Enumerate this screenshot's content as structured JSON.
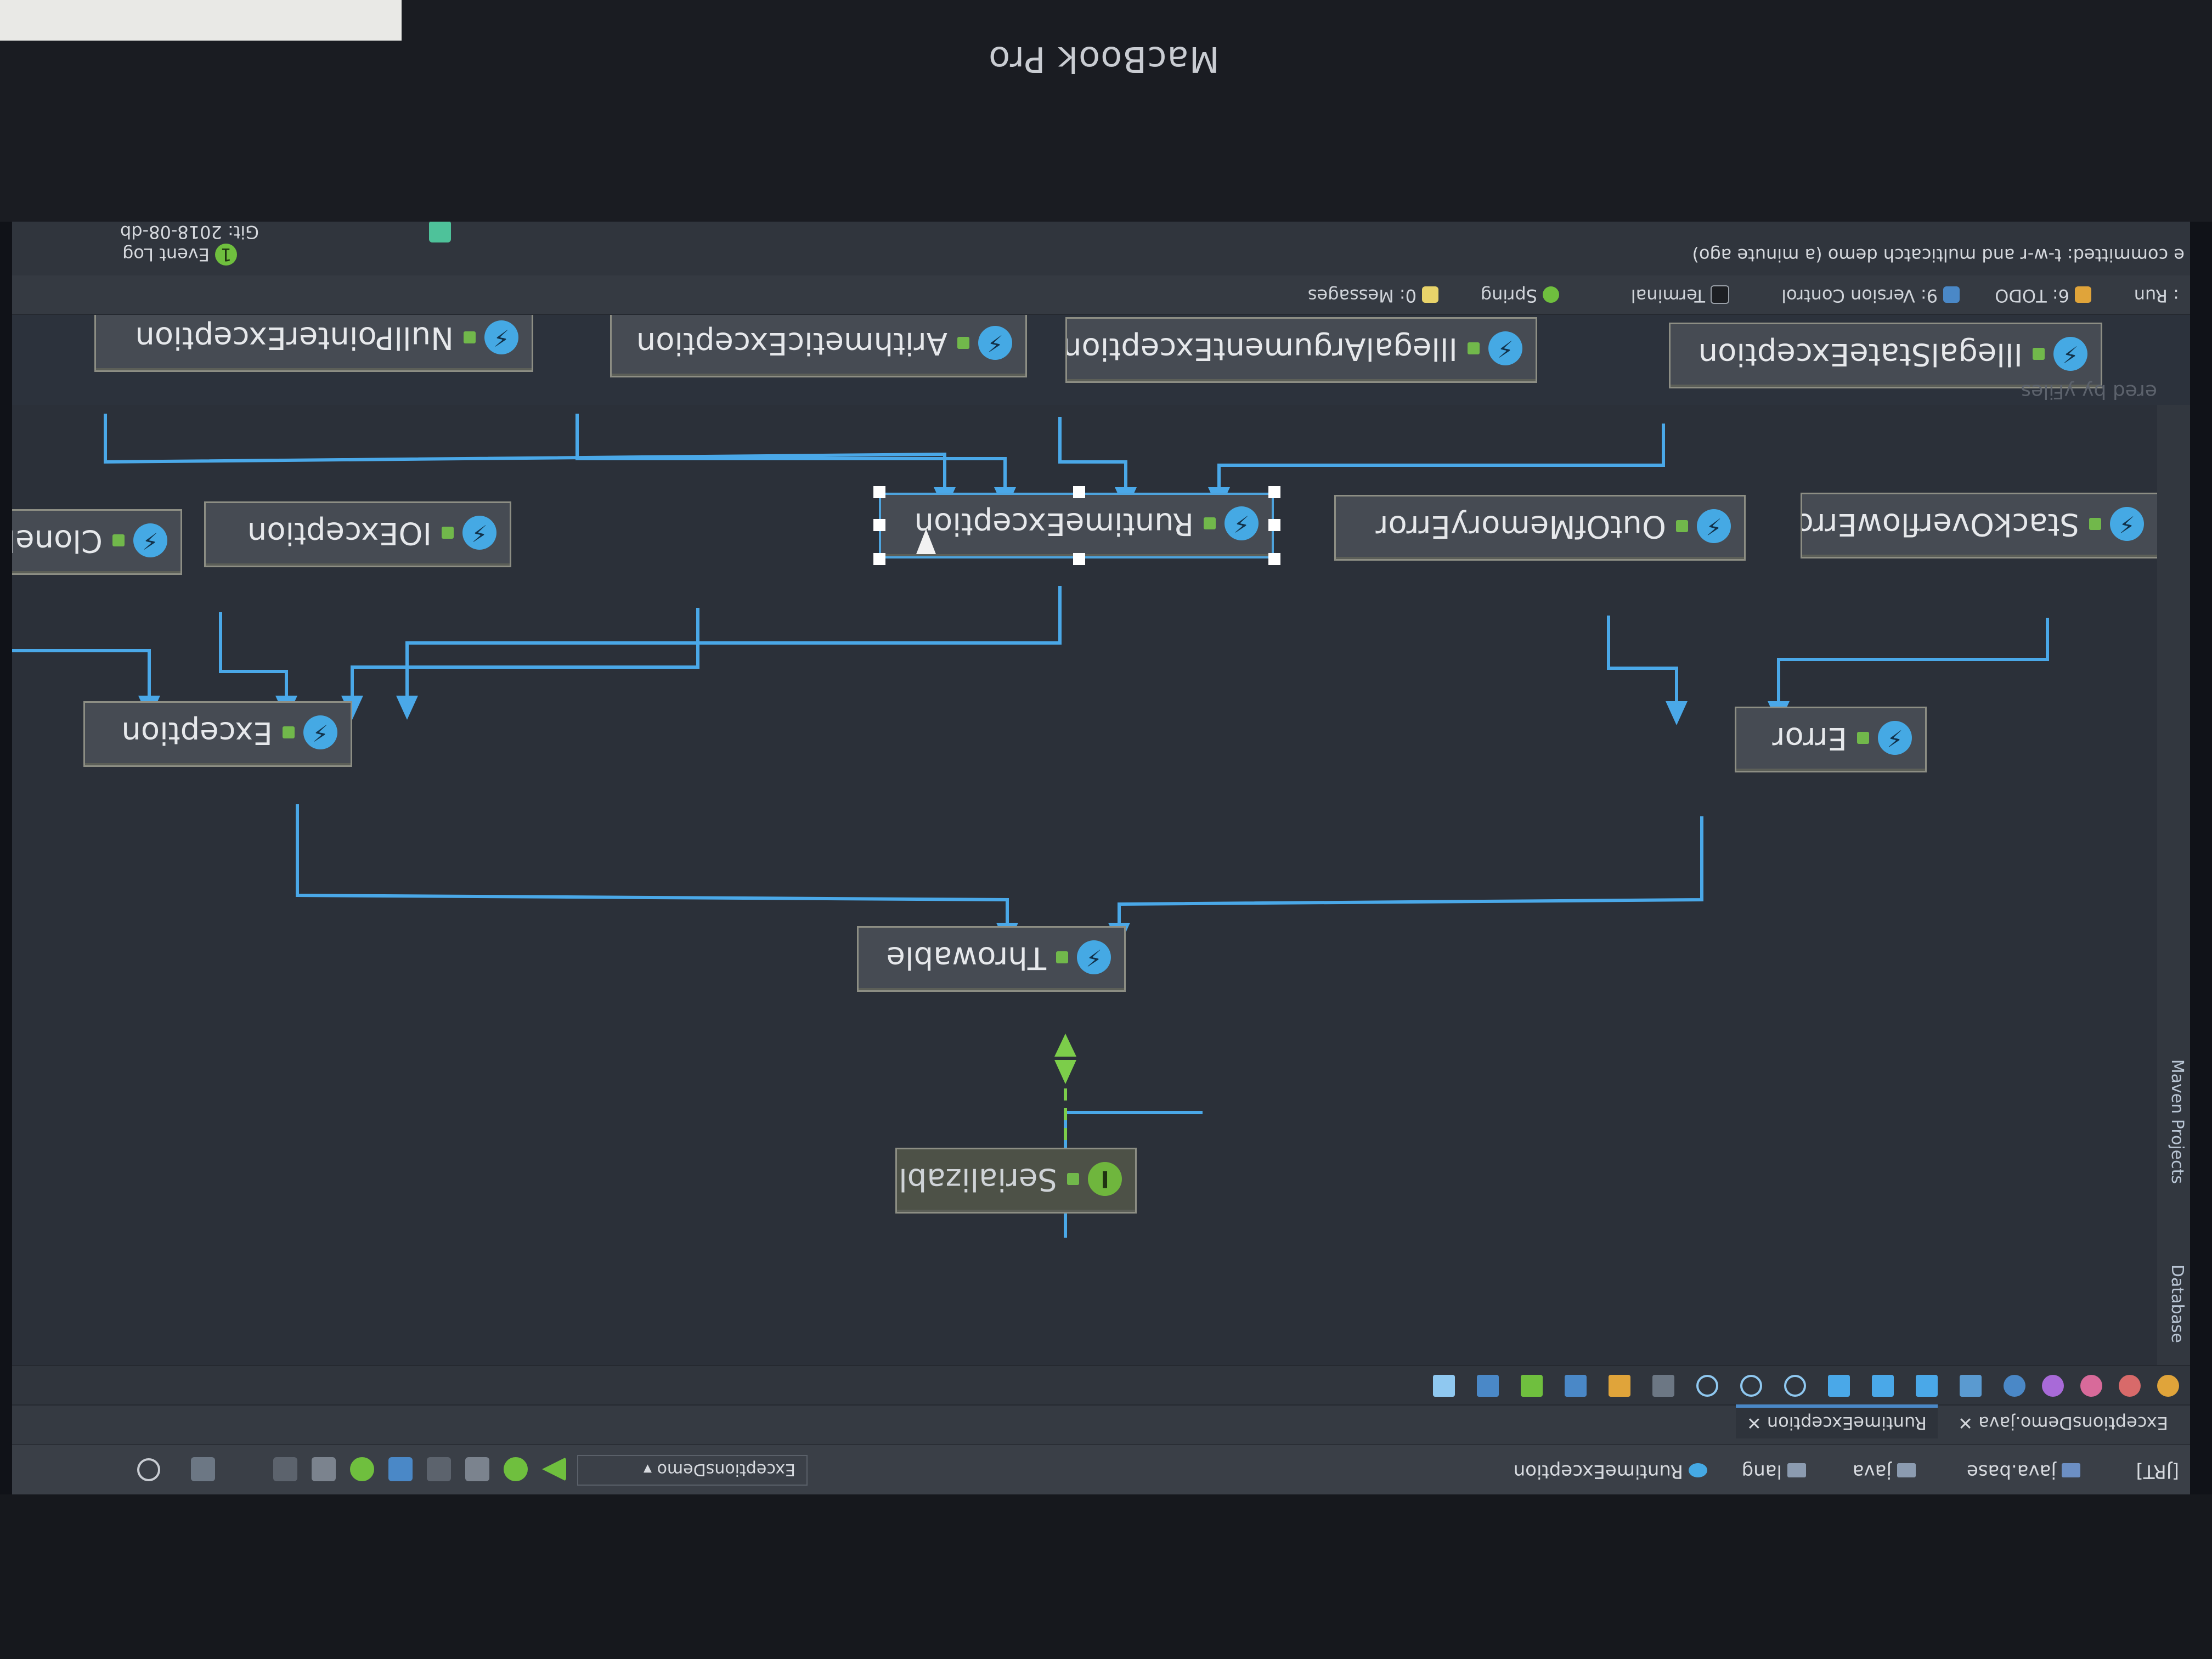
{
  "device": {
    "label": "MacBook Pro"
  },
  "breadcrumb": [
    {
      "label": "[JRT]"
    },
    {
      "label": "java.base"
    },
    {
      "label": "java"
    },
    {
      "label": "lang"
    },
    {
      "label": "RuntimeException"
    }
  ],
  "run_config": {
    "label": "ExceptionsDemo"
  },
  "tabs": [
    {
      "label": "ExceptionsDemo.java"
    },
    {
      "label": "RuntimeException"
    }
  ],
  "side_tools": [
    {
      "label": "Database"
    },
    {
      "label": "Maven Projects"
    }
  ],
  "diagram": {
    "watermark": "ered by yFiles",
    "nodes": [
      {
        "label": "Serializable",
        "kind": "interface",
        "icon": "I"
      },
      {
        "label": "Throwable",
        "kind": "class",
        "icon": "⚡"
      },
      {
        "label": "Exception",
        "kind": "class",
        "icon": "⚡"
      },
      {
        "label": "Error",
        "kind": "class",
        "icon": "⚡"
      },
      {
        "label": "CloneNotSupportedExcep",
        "kind": "class",
        "icon": "⚡"
      },
      {
        "label": "IOException",
        "kind": "class",
        "icon": "⚡"
      },
      {
        "label": "RuntimeException",
        "kind": "class",
        "icon": "⚡",
        "selected": true
      },
      {
        "label": "OutOfMemoryError",
        "kind": "class",
        "icon": "⚡"
      },
      {
        "label": "StackOverflowError",
        "kind": "class",
        "icon": "⚡"
      },
      {
        "label": "NullPointerException",
        "kind": "class",
        "icon": "⚡"
      },
      {
        "label": "ArithmeticException",
        "kind": "class",
        "icon": "⚡"
      },
      {
        "label": "IllegalArgumentException",
        "kind": "class",
        "icon": "⚡"
      },
      {
        "label": "IllegalStateException",
        "kind": "class",
        "icon": "⚡"
      }
    ],
    "colors": {
      "edge": "#4aa8e8",
      "interface_edge": "#7ccd4a"
    }
  },
  "bottom_tools": [
    {
      "label": ": Run"
    },
    {
      "label": "6: TODO"
    },
    {
      "label": "9: Version Control"
    },
    {
      "label": "Terminal"
    },
    {
      "label": "Spring"
    },
    {
      "label": "0: Messages"
    }
  ],
  "status": {
    "message": "e committed: t-w-r and multicatch demo (a minute ago)",
    "event_log": "Event Log",
    "event_count": "1",
    "git": "Git: 2018-08-db"
  }
}
